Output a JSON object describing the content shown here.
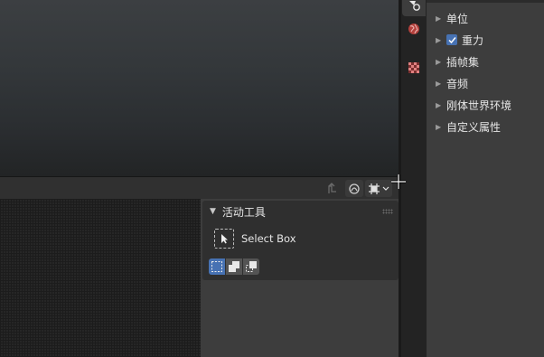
{
  "active_tool_panel": {
    "title": "活动工具",
    "tool_name": "Select Box"
  },
  "properties": {
    "rows": [
      {
        "label": "单位"
      },
      {
        "label": "重力",
        "checked": true
      },
      {
        "label": "插帧集"
      },
      {
        "label": "音频"
      },
      {
        "label": "刚体世界环境"
      },
      {
        "label": "自定义属性"
      }
    ]
  },
  "icons": {
    "scene_tab": "scene-icon",
    "world_tab": "world-icon",
    "texture_tab": "texture-icon",
    "snap": "snap-icon",
    "proportional": "proportional-editing-icon",
    "transform": "transform-pivot-icon"
  },
  "colors": {
    "accent": "#4772b3",
    "panel_bg": "#3d3d3d",
    "world_icon": "#c0504d"
  }
}
